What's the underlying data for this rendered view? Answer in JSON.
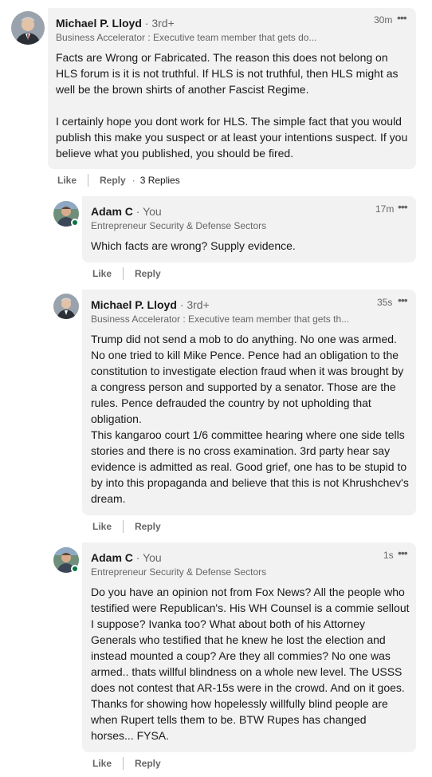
{
  "comments": [
    {
      "author": "Michael P. Lloyd",
      "degree": "· 3rd+",
      "headline": "Business Accelerator : Executive team member that gets do...",
      "time": "30m",
      "body": "Facts are Wrong or Fabricated. The reason this does not belong on HLS forum is it is not truthful. If HLS is not truthful, then HLS might as well be the brown shirts of another Fascist Regime.\n\nI certainly hope you dont work for HLS. The simple fact that you would publish this make you suspect or at least your intentions suspect. If you believe what you published, you should be fired.",
      "like": "Like",
      "reply": "Reply",
      "replies": "3 Replies"
    },
    {
      "author": "Adam C",
      "degree": "· You",
      "headline": "Entrepreneur Security & Defense Sectors",
      "time": "17m",
      "body": "Which facts are wrong? Supply evidence.",
      "like": "Like",
      "reply": "Reply"
    },
    {
      "author": "Michael P. Lloyd",
      "degree": "· 3rd+",
      "headline": "Business Accelerator : Executive team member that gets th...",
      "time": "35s",
      "body": "Trump did not send a mob to do anything. No one was armed. No one tried to kill Mike Pence. Pence had an obligation to the constitution to investigate election fraud when it was brought by a congress person and supported by a senator. Those are the rules. Pence defrauded the country by not upholding that obligation.\nThis kangaroo court 1/6 committee hearing where one side tells stories and there is no cross examination. 3rd party hear say evidence is admitted as real. Good grief, one has to be stupid to by into this propaganda and believe that this is not Khrushchev's dream.",
      "like": "Like",
      "reply": "Reply"
    },
    {
      "author": "Adam C",
      "degree": "· You",
      "headline": "Entrepreneur Security & Defense Sectors",
      "time": "1s",
      "body": "Do you have an opinion not from Fox News? All the people who testified were Republican's. His WH Counsel is a commie sellout I suppose? Ivanka too? What about both of his Attorney Generals who testified that he knew he lost the election and instead mounted a coup? Are they all commies? No one was armed.. thats willful blindness on a whole new level. The USSS does not contest that AR-15s were in the crowd. And on it goes. Thanks for showing how hopelessly willfully blind people are when Rupert tells them to be. BTW Rupes has changed horses... FYSA.",
      "like": "Like",
      "reply": "Reply"
    }
  ],
  "more_icon": "more-horizontal-icon",
  "colors": {
    "bubble": "#f2f2f2",
    "presence": "#057642",
    "muted": "#666666"
  }
}
